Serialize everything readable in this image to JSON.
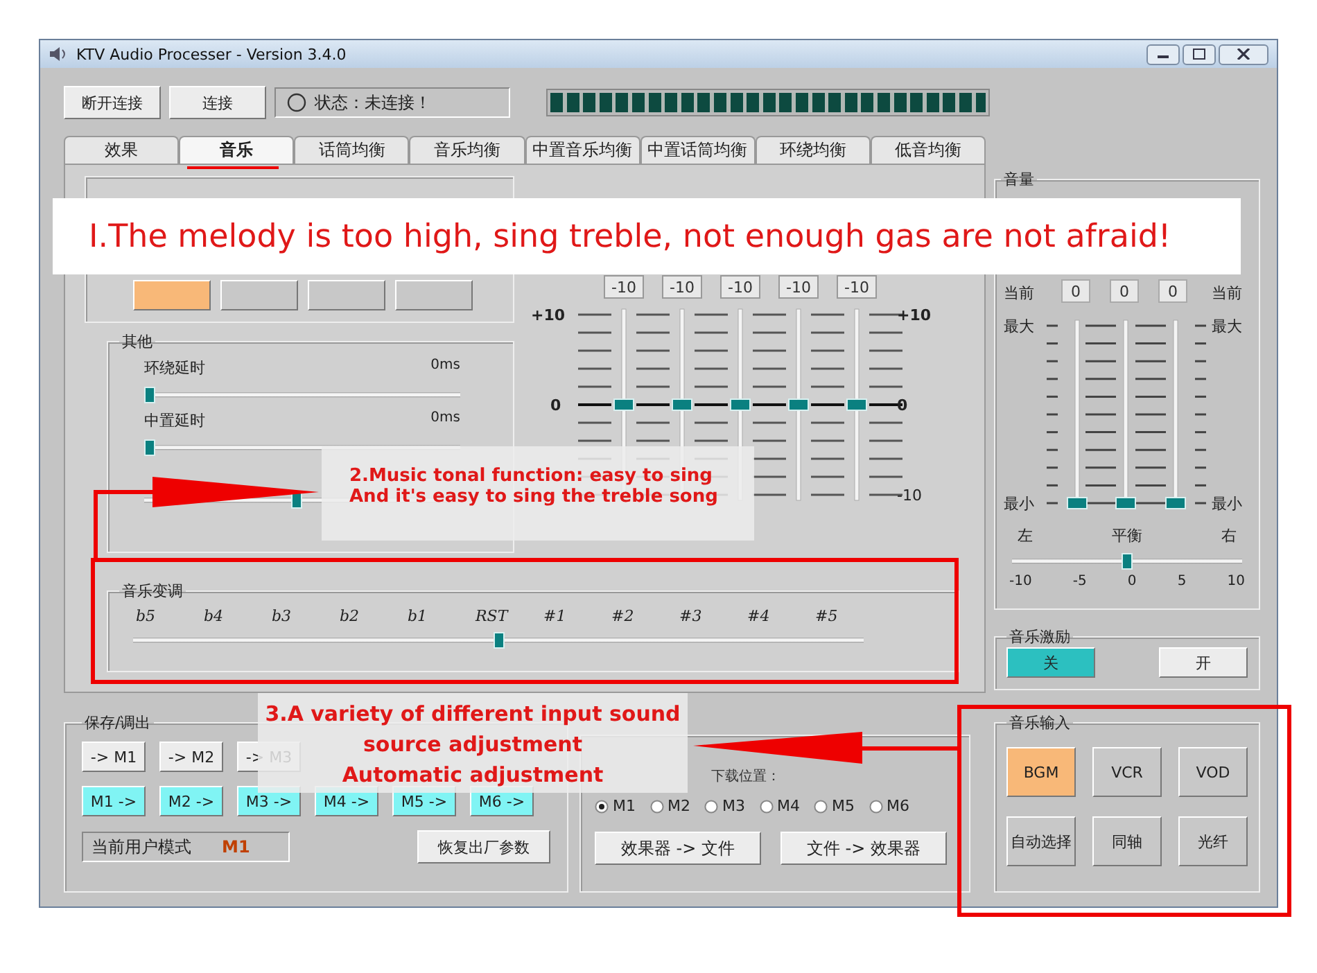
{
  "window": {
    "title": "KTV Audio Processer - Version 3.4.0"
  },
  "toolbar": {
    "disconnect_button": "断开连接",
    "connect_button": "连接",
    "status": "状态：未连接！",
    "meter": {
      "level": 1
    }
  },
  "tabs": [
    {
      "label": "效果",
      "selected": false
    },
    {
      "label": "音乐",
      "selected": true
    },
    {
      "label": "话筒均衡",
      "selected": false
    },
    {
      "label": "音乐均衡",
      "selected": false
    },
    {
      "label": "中置音乐均衡",
      "selected": false
    },
    {
      "label": "中置话筒均衡",
      "selected": false
    },
    {
      "label": "环绕均衡",
      "selected": false
    },
    {
      "label": "低音均衡",
      "selected": false
    }
  ],
  "music_tab": {
    "presets": [
      {
        "selected": true
      },
      {
        "selected": false
      },
      {
        "selected": false
      },
      {
        "selected": false
      }
    ],
    "eq": {
      "gain_values": [
        "-10",
        "-10",
        "-10",
        "-10",
        "-10"
      ],
      "left_scale": [
        "+10",
        "0"
      ],
      "right_scale": [
        "+10",
        "0",
        "-10"
      ],
      "sliders": [
        {
          "level": 0.5
        },
        {
          "level": 0.5
        },
        {
          "level": 0.5
        },
        {
          "level": 0.5
        },
        {
          "level": 0.5
        }
      ]
    },
    "other": {
      "title": "其他",
      "sliders": [
        {
          "label": "环绕延时",
          "reading": "0ms",
          "level": 0
        },
        {
          "label": "中置延时",
          "reading": "0ms",
          "level": 0
        },
        {
          "level": 0.48
        }
      ]
    },
    "key_shift": {
      "title": "音乐变调",
      "marks": [
        "b5",
        "b4",
        "b3",
        "b2",
        "b1",
        "RST",
        "#1",
        "#2",
        "#3",
        "#4",
        "#5"
      ],
      "level": 0.5
    }
  },
  "volume": {
    "title": "音量",
    "current_labels": [
      "当前",
      "当前"
    ],
    "current_values": [
      "0",
      "0",
      "0"
    ],
    "max_labels": [
      "最大",
      "最大"
    ],
    "min_labels": [
      "最小",
      "最小"
    ],
    "sliders": [
      {
        "level": 0
      },
      {
        "level": 0
      },
      {
        "level": 0
      }
    ],
    "balance": {
      "left": "左",
      "center": "平衡",
      "right": "右",
      "ticks": [
        "-10",
        "-5",
        "0",
        "5",
        "10"
      ],
      "level": 0.5
    }
  },
  "music_excite": {
    "title": "音乐激励",
    "buttons": [
      {
        "label": "关",
        "selected": true
      },
      {
        "label": "开",
        "selected": false
      }
    ]
  },
  "save_load": {
    "title": "保存/调出",
    "save_buttons": [
      {
        "label": "-> M1"
      },
      {
        "label": "-> M2"
      },
      {
        "label": "-> M3"
      }
    ],
    "load_buttons": [
      "M1 ->",
      "M2 ->",
      "M3 ->",
      "M4 ->",
      "M5 ->",
      "M6 ->"
    ],
    "mode_label": "当前用户模式",
    "mode_value": "M1",
    "reset_button": "恢复出厂参数"
  },
  "download": {
    "label": "下载位置：",
    "slots": [
      {
        "label": "M1",
        "selected": true
      },
      {
        "label": "M2",
        "selected": false
      },
      {
        "label": "M3",
        "selected": false
      },
      {
        "label": "M4",
        "selected": false
      },
      {
        "label": "M5",
        "selected": false
      },
      {
        "label": "M6",
        "selected": false
      }
    ],
    "buttons": [
      "效果器 -> 文件",
      "文件 -> 效果器"
    ]
  },
  "music_input": {
    "title": "音乐输入",
    "buttons": [
      {
        "label": "BGM",
        "selected": true
      },
      {
        "label": "VCR",
        "selected": false
      },
      {
        "label": "VOD",
        "selected": false
      },
      {
        "label": "自动选择",
        "selected": false
      },
      {
        "label": "同轴",
        "selected": false
      },
      {
        "label": "光纤",
        "selected": false
      }
    ]
  },
  "annotations": [
    {
      "lines": [
        "I.The melody is too high, sing treble, not enough gas are not afraid!"
      ]
    },
    {
      "lines": [
        "2.Music tonal function: easy to sing",
        "And it's easy to sing the treble song"
      ]
    },
    {
      "lines": [
        "3.A variety of different input sound",
        "source adjustment",
        "Automatic adjustment"
      ]
    }
  ]
}
